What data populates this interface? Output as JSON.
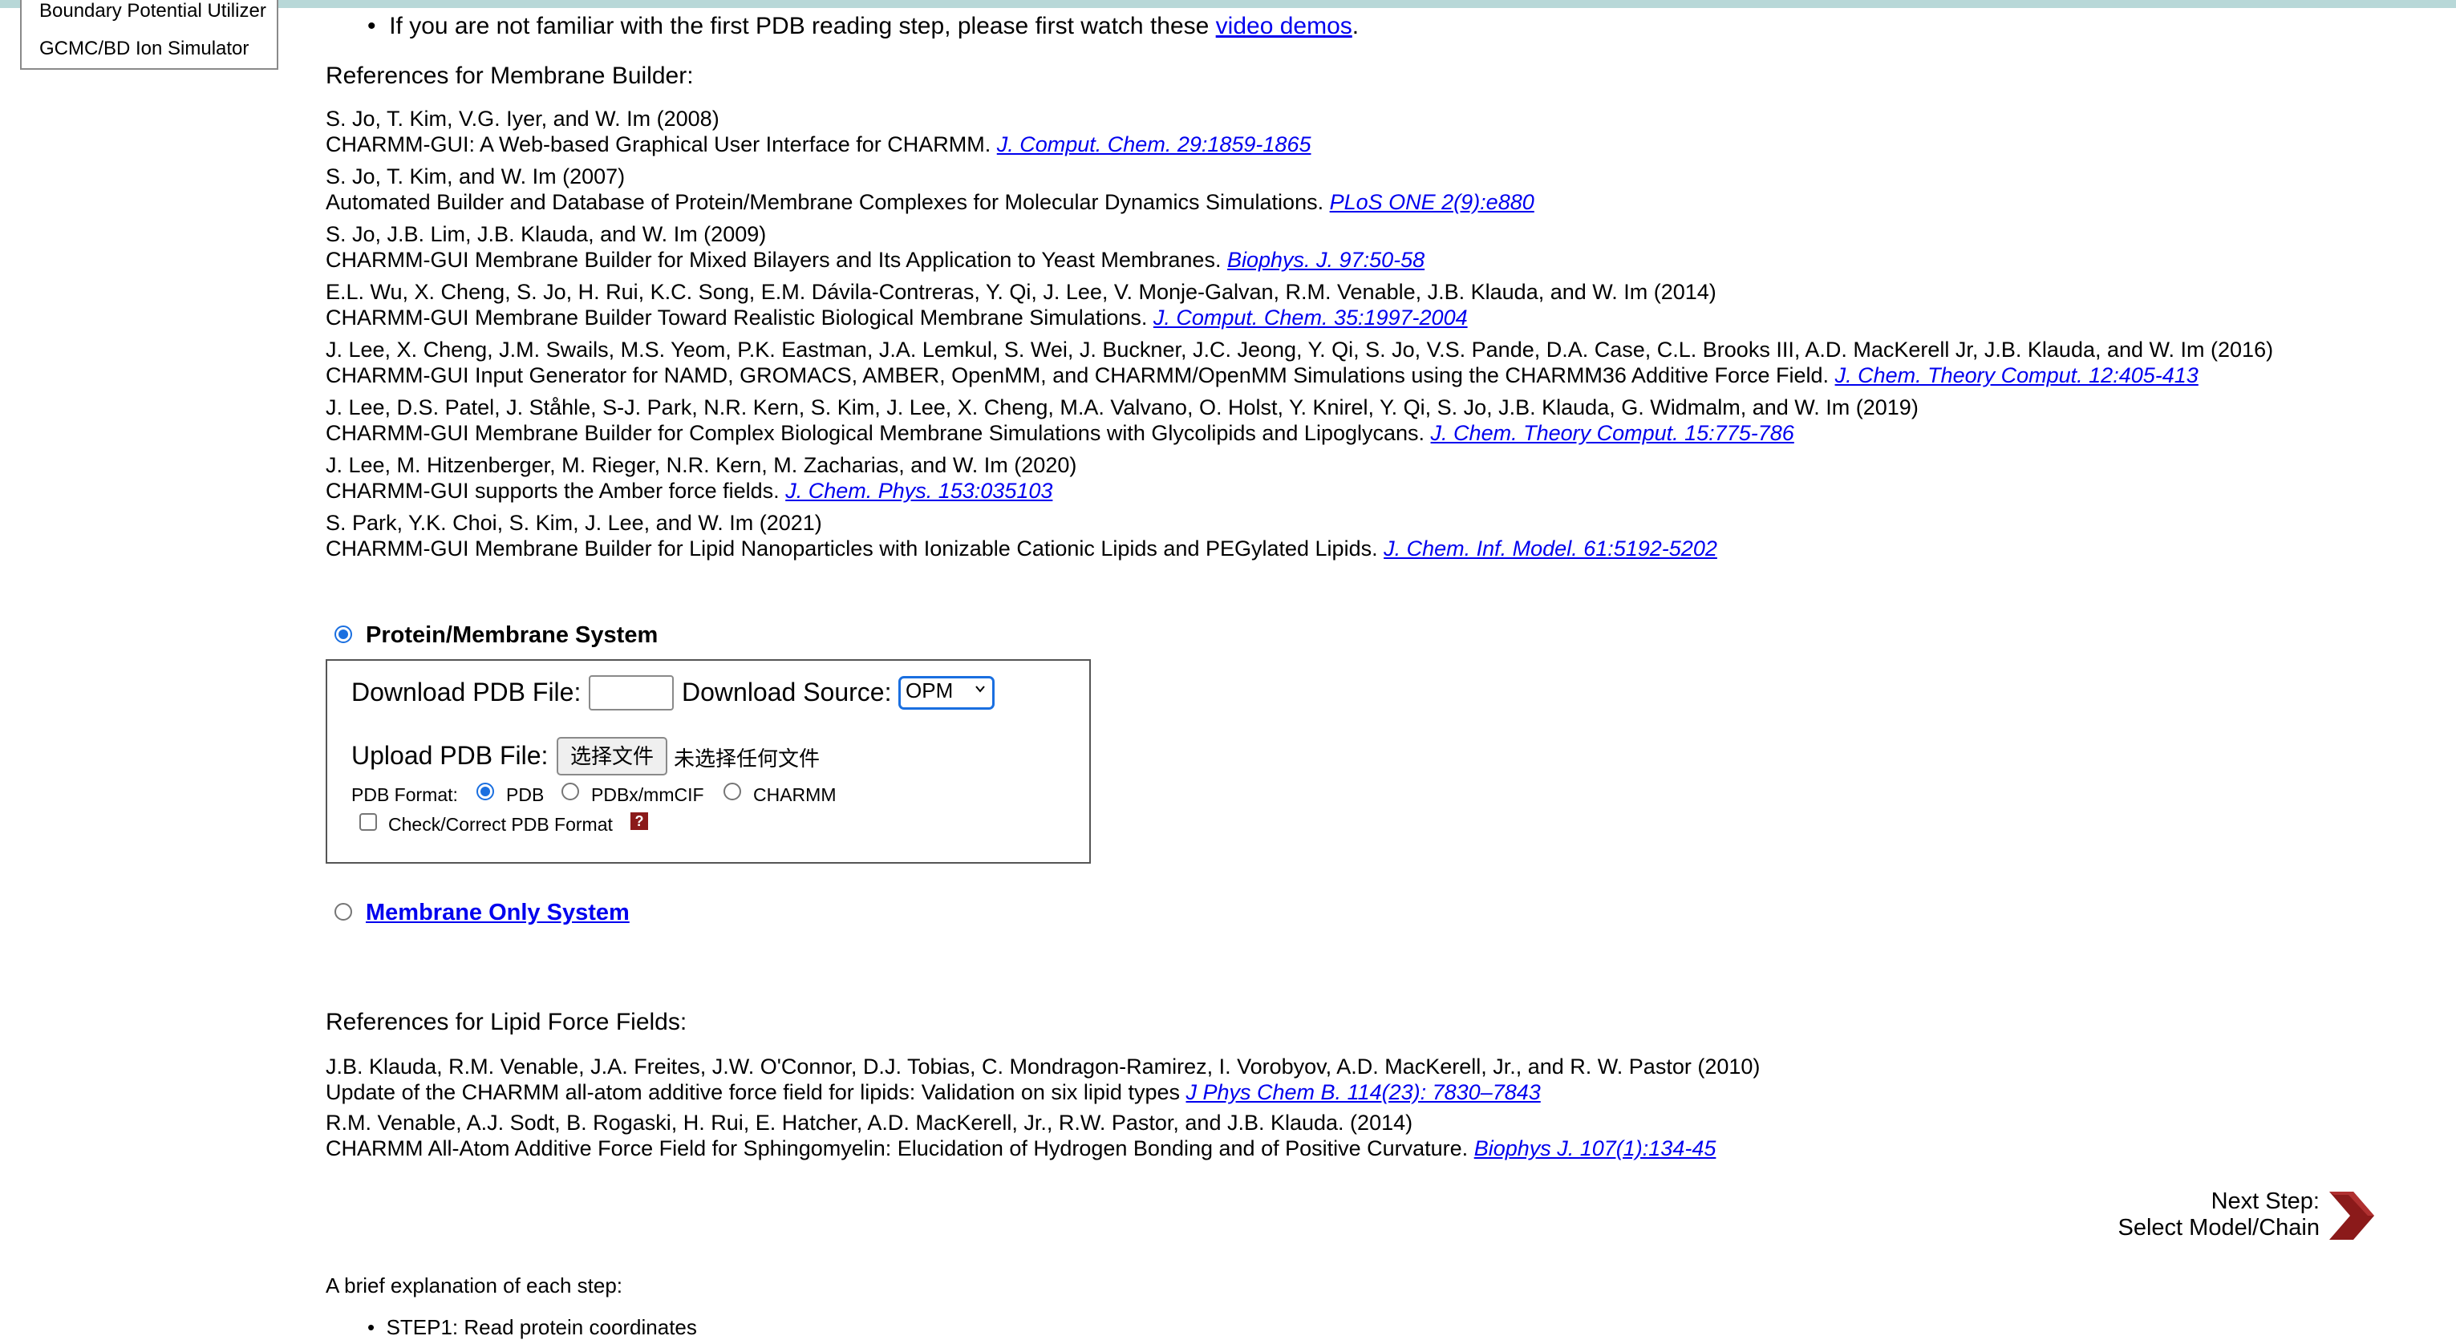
{
  "sidebar": {
    "items": [
      {
        "label": "Boundary Potential Utilizer"
      },
      {
        "label": "GCMC/BD Ion Simulator"
      }
    ]
  },
  "intro": {
    "bullet_text": "If you are not familiar with the first PDB reading step, please first watch these",
    "bullet_link": "video demos",
    "bullet_end": "."
  },
  "membrane_refs": {
    "heading": "References for Membrane Builder:",
    "items": [
      {
        "authors": "S. Jo, T. Kim, V.G. Iyer, and W. Im (2008)",
        "title": "CHARMM-GUI: A Web-based Graphical User Interface for CHARMM.",
        "citation": "J. Comput. Chem. 29:1859-1865"
      },
      {
        "authors": "S. Jo, T. Kim, and W. Im (2007)",
        "title": "Automated Builder and Database of Protein/Membrane Complexes for Molecular Dynamics Simulations.",
        "citation": "PLoS ONE 2(9):e880"
      },
      {
        "authors": "S. Jo, J.B. Lim, J.B. Klauda, and W. Im (2009)",
        "title": "CHARMM-GUI Membrane Builder for Mixed Bilayers and Its Application to Yeast Membranes.",
        "citation": "Biophys. J. 97:50-58"
      },
      {
        "authors": "E.L. Wu, X. Cheng, S. Jo, H. Rui, K.C. Song, E.M. Dávila-Contreras, Y. Qi, J. Lee, V. Monje-Galvan, R.M. Venable, J.B. Klauda, and W. Im (2014)",
        "title": "CHARMM-GUI Membrane Builder Toward Realistic Biological Membrane Simulations.",
        "citation": "J. Comput. Chem. 35:1997-2004"
      },
      {
        "authors": "J. Lee, X. Cheng, J.M. Swails, M.S. Yeom, P.K. Eastman, J.A. Lemkul, S. Wei, J. Buckner, J.C. Jeong, Y. Qi, S. Jo, V.S. Pande, D.A. Case, C.L. Brooks III, A.D. MacKerell Jr, J.B. Klauda, and W. Im (2016)",
        "title": "CHARMM-GUI Input Generator for NAMD, GROMACS, AMBER, OpenMM, and CHARMM/OpenMM Simulations using the CHARMM36 Additive Force Field.",
        "citation": "J. Chem. Theory Comput. 12:405-413"
      },
      {
        "authors": "J. Lee, D.S. Patel, J. Ståhle, S-J. Park, N.R. Kern, S. Kim, J. Lee, X. Cheng, M.A. Valvano, O. Holst, Y. Knirel, Y. Qi, S. Jo, J.B. Klauda, G. Widmalm, and W. Im (2019)",
        "title": "CHARMM-GUI Membrane Builder for Complex Biological Membrane Simulations with Glycolipids and Lipoglycans.",
        "citation": "J. Chem. Theory Comput. 15:775-786"
      },
      {
        "authors": "J. Lee, M. Hitzenberger, M. Rieger, N.R. Kern, M. Zacharias, and W. Im (2020)",
        "title": "CHARMM-GUI supports the Amber force fields.",
        "citation": "J. Chem. Phys. 153:035103"
      },
      {
        "authors": "S. Park, Y.K. Choi, S. Kim, J. Lee, and W. Im (2021)",
        "title": "CHARMM-GUI Membrane Builder for Lipid Nanoparticles with Ionizable Cationic Lipids and PEGylated Lipids.",
        "citation": "J. Chem. Inf. Model. 61:5192-5202"
      }
    ]
  },
  "system_options": {
    "protein_membrane_label": "Protein/Membrane System",
    "membrane_only_label": "Membrane Only System"
  },
  "pdb_panel": {
    "download_label": "Download PDB File:",
    "download_value": "",
    "source_label": "Download Source:",
    "source_selected": "OPM",
    "upload_label": "Upload PDB File:",
    "choose_file_button": "选择文件",
    "no_file_text": "未选择任何文件",
    "format_label": "PDB Format:",
    "format_options": [
      "PDB",
      "PDBx/mmCIF",
      "CHARMM"
    ],
    "format_selected": "PDB",
    "check_label": "Check/Correct PDB Format",
    "help_icon_text": "?"
  },
  "lipid_refs": {
    "heading": "References for Lipid Force Fields:",
    "items": [
      {
        "authors": "J.B. Klauda, R.M. Venable, J.A. Freites, J.W. O'Connor, D.J. Tobias, C. Mondragon-Ramirez, I. Vorobyov, A.D. MacKerell, Jr., and R. W. Pastor (2010)",
        "title": "Update of the CHARMM all-atom additive force field for lipids: Validation on six lipid types",
        "citation": "J Phys Chem B. 114(23): 7830–7843"
      },
      {
        "authors": "R.M. Venable, A.J. Sodt, B. Rogaski, H. Rui, E. Hatcher, A.D. MacKerell, Jr., R.W. Pastor, and J.B. Klauda. (2014)",
        "title": "CHARMM All-Atom Additive Force Field for Sphingomyelin: Elucidation of Hydrogen Bonding and of Positive Curvature.",
        "citation": "Biophys J. 107(1):134-45"
      }
    ]
  },
  "next_step": {
    "line1": "Next Step:",
    "line2": "Select Model/Chain"
  },
  "explanation": {
    "heading": "A brief explanation of each step:",
    "first_item": "STEP1: Read protein coordinates"
  },
  "colors": {
    "link": "#0000ee",
    "radio_accent": "#1a6fe0",
    "next_arrow": "#8b1a1a",
    "top_bar": "#b8d8d8"
  }
}
